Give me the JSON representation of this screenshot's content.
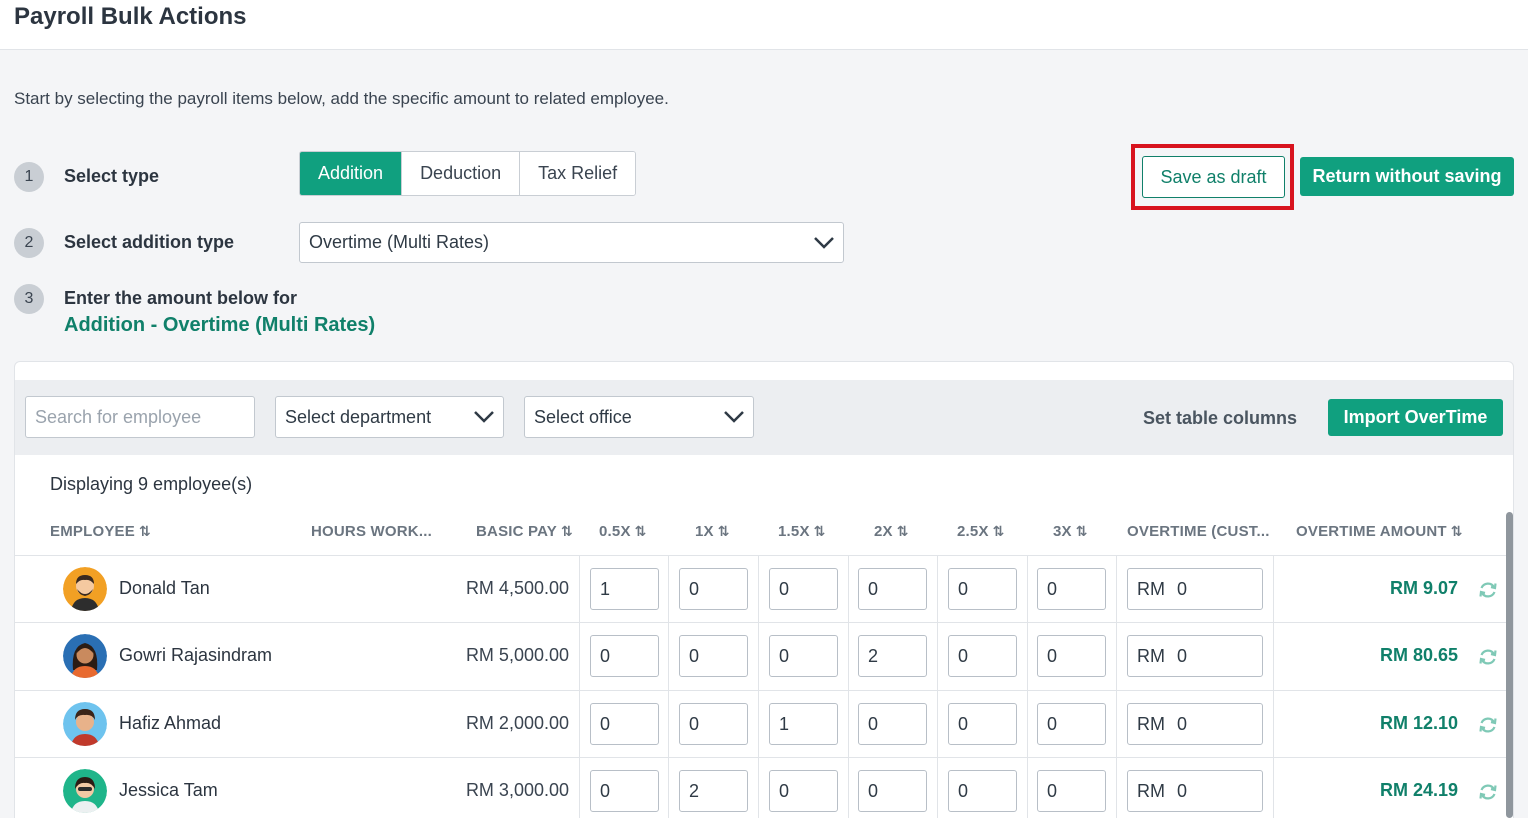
{
  "header": {
    "title": "Payroll Bulk Actions"
  },
  "intro": "Start by selecting the payroll items below, add the specific amount to related employee.",
  "steps": [
    {
      "num": "1",
      "label": "Select type"
    },
    {
      "num": "2",
      "label": "Select addition type"
    },
    {
      "num": "3",
      "label": "Enter the amount below for",
      "sub": "Addition - Overtime (Multi Rates)"
    }
  ],
  "type_tabs": [
    {
      "label": "Addition",
      "active": true
    },
    {
      "label": "Deduction",
      "active": false
    },
    {
      "label": "Tax Relief",
      "active": false
    }
  ],
  "addition_type": {
    "value": "Overtime (Multi Rates)"
  },
  "actions": {
    "save_draft": "Save as draft",
    "return": "Return without saving"
  },
  "filters": {
    "search_placeholder": "Search for employee",
    "department": "Select department",
    "office": "Select office",
    "set_columns": "Set table columns",
    "import": "Import OverTime"
  },
  "display_count": "Displaying 9 employee(s)",
  "columns": {
    "employee": "EMPLOYEE",
    "hours": "HOURS WORK...",
    "basic_pay": "BASIC PAY",
    "r05": "0.5X",
    "r1": "1X",
    "r15": "1.5X",
    "r2": "2X",
    "r25": "2.5X",
    "r3": "3X",
    "custom": "OVERTIME (CUST...",
    "amount": "OVERTIME AMOUNT"
  },
  "currency": "RM",
  "rows": [
    {
      "name": "Donald Tan",
      "basic_pay": "RM 4,500.00",
      "rates": [
        "1",
        "0",
        "0",
        "0",
        "0",
        "0"
      ],
      "custom": "0",
      "amount": "RM 9.07"
    },
    {
      "name": "Gowri Rajasindram",
      "basic_pay": "RM 5,000.00",
      "rates": [
        "0",
        "0",
        "0",
        "2",
        "0",
        "0"
      ],
      "custom": "0",
      "amount": "RM 80.65"
    },
    {
      "name": "Hafiz Ahmad",
      "basic_pay": "RM 2,000.00",
      "rates": [
        "0",
        "0",
        "1",
        "0",
        "0",
        "0"
      ],
      "custom": "0",
      "amount": "RM 12.10"
    },
    {
      "name": "Jessica Tam",
      "basic_pay": "RM 3,000.00",
      "rates": [
        "0",
        "2",
        "0",
        "0",
        "0",
        "0"
      ],
      "custom": "0",
      "amount": "RM 24.19"
    }
  ],
  "colors": {
    "accent": "#10a07f",
    "accent_text": "#10806a",
    "highlight": "#d8131e"
  }
}
